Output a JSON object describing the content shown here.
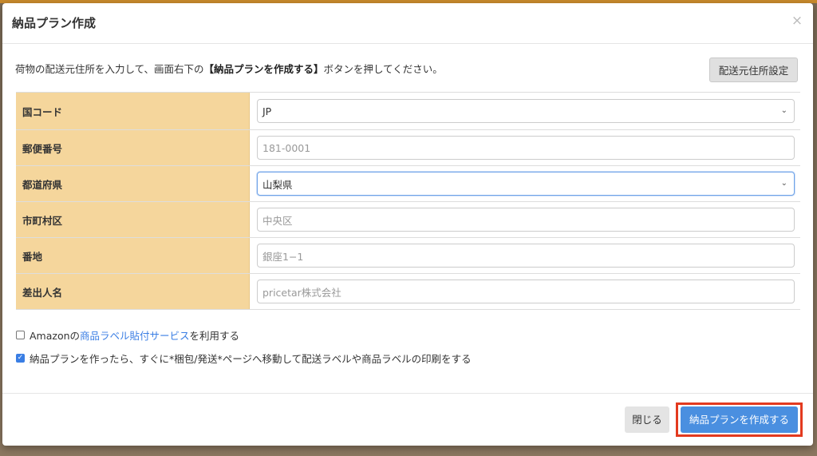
{
  "modal": {
    "title": "納品プラン作成",
    "close_glyph": "×"
  },
  "instruction": {
    "before": "荷物の配送元住所を入力して、画面右下の",
    "emphasis": "【納品プランを作成する】",
    "after": "ボタンを押してください。"
  },
  "settings_button": "配送元住所設定",
  "form": {
    "rows": [
      {
        "label": "国コード",
        "type": "select",
        "value": "JP"
      },
      {
        "label": "郵便番号",
        "type": "input",
        "placeholder": "181-0001"
      },
      {
        "label": "都道府県",
        "type": "select",
        "value": "山梨県"
      },
      {
        "label": "市町村区",
        "type": "input",
        "placeholder": "中央区"
      },
      {
        "label": "番地",
        "type": "input",
        "placeholder": "銀座1−1"
      },
      {
        "label": "差出人名",
        "type": "input",
        "placeholder": "pricetar株式会社"
      }
    ]
  },
  "options": {
    "label_service": {
      "checked": false,
      "prefix": "Amazonの",
      "link": "商品ラベル貼付サービス",
      "suffix": "を利用する"
    },
    "auto_move": {
      "checked": true,
      "text": "納品プランを作ったら、すぐに*梱包/発送*ページへ移動して配送ラベルや商品ラベルの印刷をする"
    }
  },
  "footer": {
    "close_label": "閉じる",
    "create_label": "納品プランを作成する"
  },
  "colors": {
    "label_bg": "#f5d69c",
    "primary": "#4a8fe0",
    "highlight": "#e33a1f",
    "link": "#3a7ee4"
  }
}
